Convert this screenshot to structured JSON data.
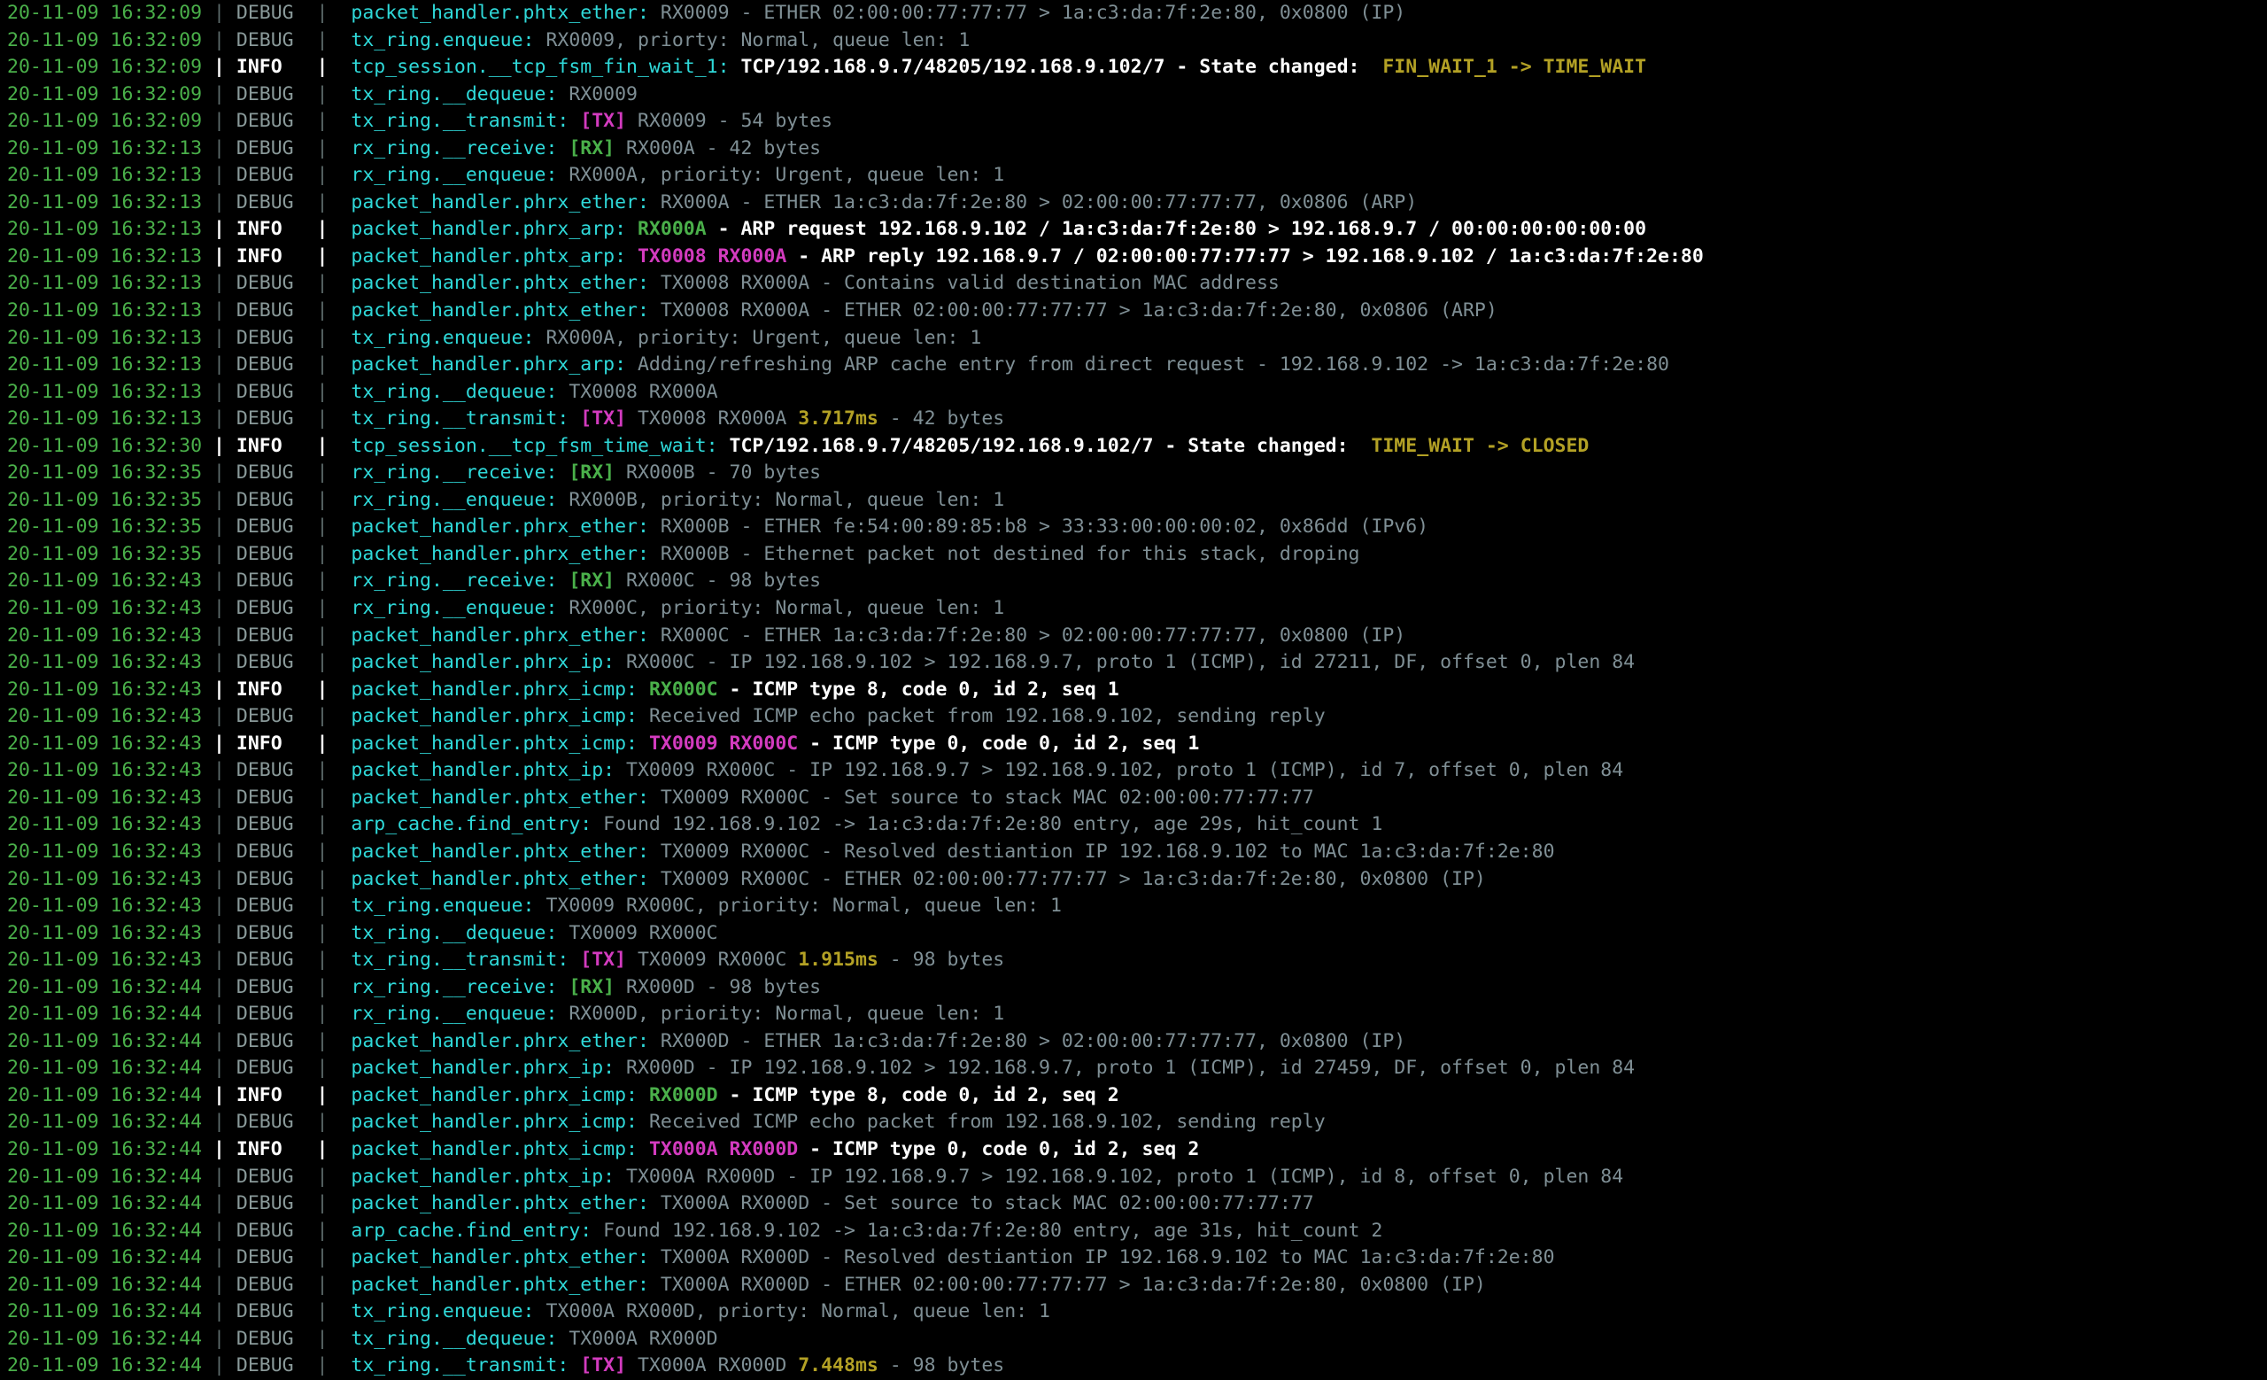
{
  "terminal": {
    "title": "network stack debug log",
    "background": "#000000",
    "colors": {
      "timestamp": "#4ab04a",
      "separator": "#5c6a6a",
      "level_debug": "#8a9a9a",
      "level_info": "#ffffff",
      "module": "#2fd9d9",
      "message_debug": "#7f8f95",
      "message_info": "#ffffff",
      "rx_label": "#4ab04a",
      "tx_label": "#d33bbf",
      "timing": "#b3a125",
      "state_transition": "#b3a125"
    },
    "levels": {
      "debug": "DEBUG",
      "info": "INFO"
    },
    "separator": "|",
    "lines": [
      {
        "ts": "20-11-09 16:32:09",
        "level": "DEBUG",
        "module": "packet_handler.phtx_ether",
        "parts": [
          {
            "t": "msg",
            "v": "RX0009 - ETHER 02:00:00:77:77:77 > 1a:c3:da:7f:2e:80, 0x0800 (IP)"
          }
        ]
      },
      {
        "ts": "20-11-09 16:32:09",
        "level": "DEBUG",
        "module": "tx_ring.enqueue",
        "parts": [
          {
            "t": "msg",
            "v": "RX0009, priorty: Normal, queue len: 1"
          }
        ]
      },
      {
        "ts": "20-11-09 16:32:09",
        "level": "INFO",
        "module": "tcp_session.__tcp_fsm_fin_wait_1",
        "parts": [
          {
            "t": "msg",
            "v": "TCP/192.168.9.7/48205/192.168.9.102/7 - State changed:  "
          },
          {
            "t": "state",
            "v": "FIN_WAIT_1 -> TIME_WAIT"
          }
        ]
      },
      {
        "ts": "20-11-09 16:32:09",
        "level": "DEBUG",
        "module": "tx_ring.__dequeue",
        "parts": [
          {
            "t": "msg",
            "v": "RX0009"
          }
        ]
      },
      {
        "ts": "20-11-09 16:32:09",
        "level": "DEBUG",
        "module": "tx_ring.__transmit",
        "parts": [
          {
            "t": "tx",
            "v": "[TX]"
          },
          {
            "t": "msg",
            "v": " RX0009 - 54 bytes"
          }
        ]
      },
      {
        "ts": "20-11-09 16:32:13",
        "level": "DEBUG",
        "module": "rx_ring.__receive",
        "parts": [
          {
            "t": "rx",
            "v": "[RX]"
          },
          {
            "t": "msg",
            "v": " RX000A - 42 bytes"
          }
        ]
      },
      {
        "ts": "20-11-09 16:32:13",
        "level": "DEBUG",
        "module": "rx_ring.__enqueue",
        "parts": [
          {
            "t": "msg",
            "v": "RX000A, priority: Urgent, queue len: 1"
          }
        ]
      },
      {
        "ts": "20-11-09 16:32:13",
        "level": "DEBUG",
        "module": "packet_handler.phrx_ether",
        "parts": [
          {
            "t": "msg",
            "v": "RX000A - ETHER 1a:c3:da:7f:2e:80 > 02:00:00:77:77:77, 0x0806 (ARP)"
          }
        ]
      },
      {
        "ts": "20-11-09 16:32:13",
        "level": "INFO",
        "module": "packet_handler.phrx_arp",
        "parts": [
          {
            "t": "rx",
            "v": "RX000A"
          },
          {
            "t": "msg",
            "v": " - ARP request 192.168.9.102 / 1a:c3:da:7f:2e:80 > 192.168.9.7 / 00:00:00:00:00:00"
          }
        ]
      },
      {
        "ts": "20-11-09 16:32:13",
        "level": "INFO",
        "module": "packet_handler.phtx_arp",
        "parts": [
          {
            "t": "tx",
            "v": "TX0008 RX000A"
          },
          {
            "t": "msg",
            "v": " - ARP reply 192.168.9.7 / 02:00:00:77:77:77 > 192.168.9.102 / 1a:c3:da:7f:2e:80"
          }
        ]
      },
      {
        "ts": "20-11-09 16:32:13",
        "level": "DEBUG",
        "module": "packet_handler.phtx_ether",
        "parts": [
          {
            "t": "msg",
            "v": "TX0008 RX000A - Contains valid destination MAC address"
          }
        ]
      },
      {
        "ts": "20-11-09 16:32:13",
        "level": "DEBUG",
        "module": "packet_handler.phtx_ether",
        "parts": [
          {
            "t": "msg",
            "v": "TX0008 RX000A - ETHER 02:00:00:77:77:77 > 1a:c3:da:7f:2e:80, 0x0806 (ARP)"
          }
        ]
      },
      {
        "ts": "20-11-09 16:32:13",
        "level": "DEBUG",
        "module": "tx_ring.enqueue",
        "parts": [
          {
            "t": "msg",
            "v": "RX000A, priority: Urgent, queue len: 1"
          }
        ]
      },
      {
        "ts": "20-11-09 16:32:13",
        "level": "DEBUG",
        "module": "packet_handler.phrx_arp",
        "parts": [
          {
            "t": "msg",
            "v": "Adding/refreshing ARP cache entry from direct request - 192.168.9.102 -> 1a:c3:da:7f:2e:80"
          }
        ]
      },
      {
        "ts": "20-11-09 16:32:13",
        "level": "DEBUG",
        "module": "tx_ring.__dequeue",
        "parts": [
          {
            "t": "msg",
            "v": "TX0008 RX000A"
          }
        ]
      },
      {
        "ts": "20-11-09 16:32:13",
        "level": "DEBUG",
        "module": "tx_ring.__transmit",
        "parts": [
          {
            "t": "tx",
            "v": "[TX]"
          },
          {
            "t": "msg",
            "v": " TX0008 RX000A "
          },
          {
            "t": "ms",
            "v": "3.717ms"
          },
          {
            "t": "msg",
            "v": " - 42 bytes"
          }
        ]
      },
      {
        "ts": "20-11-09 16:32:30",
        "level": "INFO",
        "module": "tcp_session.__tcp_fsm_time_wait",
        "parts": [
          {
            "t": "msg",
            "v": "TCP/192.168.9.7/48205/192.168.9.102/7 - State changed:  "
          },
          {
            "t": "state",
            "v": "TIME_WAIT -> CLOSED"
          }
        ]
      },
      {
        "ts": "20-11-09 16:32:35",
        "level": "DEBUG",
        "module": "rx_ring.__receive",
        "parts": [
          {
            "t": "rx",
            "v": "[RX]"
          },
          {
            "t": "msg",
            "v": " RX000B - 70 bytes"
          }
        ]
      },
      {
        "ts": "20-11-09 16:32:35",
        "level": "DEBUG",
        "module": "rx_ring.__enqueue",
        "parts": [
          {
            "t": "msg",
            "v": "RX000B, priority: Normal, queue len: 1"
          }
        ]
      },
      {
        "ts": "20-11-09 16:32:35",
        "level": "DEBUG",
        "module": "packet_handler.phrx_ether",
        "parts": [
          {
            "t": "msg",
            "v": "RX000B - ETHER fe:54:00:89:85:b8 > 33:33:00:00:00:02, 0x86dd (IPv6)"
          }
        ]
      },
      {
        "ts": "20-11-09 16:32:35",
        "level": "DEBUG",
        "module": "packet_handler.phrx_ether",
        "parts": [
          {
            "t": "msg",
            "v": "RX000B - Ethernet packet not destined for this stack, droping"
          }
        ]
      },
      {
        "ts": "20-11-09 16:32:43",
        "level": "DEBUG",
        "module": "rx_ring.__receive",
        "parts": [
          {
            "t": "rx",
            "v": "[RX]"
          },
          {
            "t": "msg",
            "v": " RX000C - 98 bytes"
          }
        ]
      },
      {
        "ts": "20-11-09 16:32:43",
        "level": "DEBUG",
        "module": "rx_ring.__enqueue",
        "parts": [
          {
            "t": "msg",
            "v": "RX000C, priority: Normal, queue len: 1"
          }
        ]
      },
      {
        "ts": "20-11-09 16:32:43",
        "level": "DEBUG",
        "module": "packet_handler.phrx_ether",
        "parts": [
          {
            "t": "msg",
            "v": "RX000C - ETHER 1a:c3:da:7f:2e:80 > 02:00:00:77:77:77, 0x0800 (IP)"
          }
        ]
      },
      {
        "ts": "20-11-09 16:32:43",
        "level": "DEBUG",
        "module": "packet_handler.phrx_ip",
        "parts": [
          {
            "t": "msg",
            "v": "RX000C - IP 192.168.9.102 > 192.168.9.7, proto 1 (ICMP), id 27211, DF, offset 0, plen 84"
          }
        ]
      },
      {
        "ts": "20-11-09 16:32:43",
        "level": "INFO",
        "module": "packet_handler.phrx_icmp",
        "parts": [
          {
            "t": "rx",
            "v": "RX000C"
          },
          {
            "t": "msg",
            "v": " - ICMP type 8, code 0, id 2, seq 1"
          }
        ]
      },
      {
        "ts": "20-11-09 16:32:43",
        "level": "DEBUG",
        "module": "packet_handler.phrx_icmp",
        "parts": [
          {
            "t": "msg",
            "v": "Received ICMP echo packet from 192.168.9.102, sending reply"
          }
        ]
      },
      {
        "ts": "20-11-09 16:32:43",
        "level": "INFO",
        "module": "packet_handler.phtx_icmp",
        "parts": [
          {
            "t": "tx",
            "v": "TX0009 RX000C"
          },
          {
            "t": "msg",
            "v": " - ICMP type 0, code 0, id 2, seq 1"
          }
        ]
      },
      {
        "ts": "20-11-09 16:32:43",
        "level": "DEBUG",
        "module": "packet_handler.phtx_ip",
        "parts": [
          {
            "t": "msg",
            "v": "TX0009 RX000C - IP 192.168.9.7 > 192.168.9.102, proto 1 (ICMP), id 7, offset 0, plen 84"
          }
        ]
      },
      {
        "ts": "20-11-09 16:32:43",
        "level": "DEBUG",
        "module": "packet_handler.phtx_ether",
        "parts": [
          {
            "t": "msg",
            "v": "TX0009 RX000C - Set source to stack MAC 02:00:00:77:77:77"
          }
        ]
      },
      {
        "ts": "20-11-09 16:32:43",
        "level": "DEBUG",
        "module": "arp_cache.find_entry",
        "parts": [
          {
            "t": "msg",
            "v": "Found 192.168.9.102 -> 1a:c3:da:7f:2e:80 entry, age 29s, hit_count 1"
          }
        ]
      },
      {
        "ts": "20-11-09 16:32:43",
        "level": "DEBUG",
        "module": "packet_handler.phtx_ether",
        "parts": [
          {
            "t": "msg",
            "v": "TX0009 RX000C - Resolved destiantion IP 192.168.9.102 to MAC 1a:c3:da:7f:2e:80"
          }
        ]
      },
      {
        "ts": "20-11-09 16:32:43",
        "level": "DEBUG",
        "module": "packet_handler.phtx_ether",
        "parts": [
          {
            "t": "msg",
            "v": "TX0009 RX000C - ETHER 02:00:00:77:77:77 > 1a:c3:da:7f:2e:80, 0x0800 (IP)"
          }
        ]
      },
      {
        "ts": "20-11-09 16:32:43",
        "level": "DEBUG",
        "module": "tx_ring.enqueue",
        "parts": [
          {
            "t": "msg",
            "v": "TX0009 RX000C, priority: Normal, queue len: 1"
          }
        ]
      },
      {
        "ts": "20-11-09 16:32:43",
        "level": "DEBUG",
        "module": "tx_ring.__dequeue",
        "parts": [
          {
            "t": "msg",
            "v": "TX0009 RX000C"
          }
        ]
      },
      {
        "ts": "20-11-09 16:32:43",
        "level": "DEBUG",
        "module": "tx_ring.__transmit",
        "parts": [
          {
            "t": "tx",
            "v": "[TX]"
          },
          {
            "t": "msg",
            "v": " TX0009 RX000C "
          },
          {
            "t": "ms",
            "v": "1.915ms"
          },
          {
            "t": "msg",
            "v": " - 98 bytes"
          }
        ]
      },
      {
        "ts": "20-11-09 16:32:44",
        "level": "DEBUG",
        "module": "rx_ring.__receive",
        "parts": [
          {
            "t": "rx",
            "v": "[RX]"
          },
          {
            "t": "msg",
            "v": " RX000D - 98 bytes"
          }
        ]
      },
      {
        "ts": "20-11-09 16:32:44",
        "level": "DEBUG",
        "module": "rx_ring.__enqueue",
        "parts": [
          {
            "t": "msg",
            "v": "RX000D, priority: Normal, queue len: 1"
          }
        ]
      },
      {
        "ts": "20-11-09 16:32:44",
        "level": "DEBUG",
        "module": "packet_handler.phrx_ether",
        "parts": [
          {
            "t": "msg",
            "v": "RX000D - ETHER 1a:c3:da:7f:2e:80 > 02:00:00:77:77:77, 0x0800 (IP)"
          }
        ]
      },
      {
        "ts": "20-11-09 16:32:44",
        "level": "DEBUG",
        "module": "packet_handler.phrx_ip",
        "parts": [
          {
            "t": "msg",
            "v": "RX000D - IP 192.168.9.102 > 192.168.9.7, proto 1 (ICMP), id 27459, DF, offset 0, plen 84"
          }
        ]
      },
      {
        "ts": "20-11-09 16:32:44",
        "level": "INFO",
        "module": "packet_handler.phrx_icmp",
        "parts": [
          {
            "t": "rx",
            "v": "RX000D"
          },
          {
            "t": "msg",
            "v": " - ICMP type 8, code 0, id 2, seq 2"
          }
        ]
      },
      {
        "ts": "20-11-09 16:32:44",
        "level": "DEBUG",
        "module": "packet_handler.phrx_icmp",
        "parts": [
          {
            "t": "msg",
            "v": "Received ICMP echo packet from 192.168.9.102, sending reply"
          }
        ]
      },
      {
        "ts": "20-11-09 16:32:44",
        "level": "INFO",
        "module": "packet_handler.phtx_icmp",
        "parts": [
          {
            "t": "tx",
            "v": "TX000A RX000D"
          },
          {
            "t": "msg",
            "v": " - ICMP type 0, code 0, id 2, seq 2"
          }
        ]
      },
      {
        "ts": "20-11-09 16:32:44",
        "level": "DEBUG",
        "module": "packet_handler.phtx_ip",
        "parts": [
          {
            "t": "msg",
            "v": "TX000A RX000D - IP 192.168.9.7 > 192.168.9.102, proto 1 (ICMP), id 8, offset 0, plen 84"
          }
        ]
      },
      {
        "ts": "20-11-09 16:32:44",
        "level": "DEBUG",
        "module": "packet_handler.phtx_ether",
        "parts": [
          {
            "t": "msg",
            "v": "TX000A RX000D - Set source to stack MAC 02:00:00:77:77:77"
          }
        ]
      },
      {
        "ts": "20-11-09 16:32:44",
        "level": "DEBUG",
        "module": "arp_cache.find_entry",
        "parts": [
          {
            "t": "msg",
            "v": "Found 192.168.9.102 -> 1a:c3:da:7f:2e:80 entry, age 31s, hit_count 2"
          }
        ]
      },
      {
        "ts": "20-11-09 16:32:44",
        "level": "DEBUG",
        "module": "packet_handler.phtx_ether",
        "parts": [
          {
            "t": "msg",
            "v": "TX000A RX000D - Resolved destiantion IP 192.168.9.102 to MAC 1a:c3:da:7f:2e:80"
          }
        ]
      },
      {
        "ts": "20-11-09 16:32:44",
        "level": "DEBUG",
        "module": "packet_handler.phtx_ether",
        "parts": [
          {
            "t": "msg",
            "v": "TX000A RX000D - ETHER 02:00:00:77:77:77 > 1a:c3:da:7f:2e:80, 0x0800 (IP)"
          }
        ]
      },
      {
        "ts": "20-11-09 16:32:44",
        "level": "DEBUG",
        "module": "tx_ring.enqueue",
        "parts": [
          {
            "t": "msg",
            "v": "TX000A RX000D, priorty: Normal, queue len: 1"
          }
        ]
      },
      {
        "ts": "20-11-09 16:32:44",
        "level": "DEBUG",
        "module": "tx_ring.__dequeue",
        "parts": [
          {
            "t": "msg",
            "v": "TX000A RX000D"
          }
        ]
      },
      {
        "ts": "20-11-09 16:32:44",
        "level": "DEBUG",
        "module": "tx_ring.__transmit",
        "parts": [
          {
            "t": "tx",
            "v": "[TX]"
          },
          {
            "t": "msg",
            "v": " TX000A RX000D "
          },
          {
            "t": "ms",
            "v": "7.448ms"
          },
          {
            "t": "msg",
            "v": " - 98 bytes"
          }
        ]
      }
    ]
  }
}
